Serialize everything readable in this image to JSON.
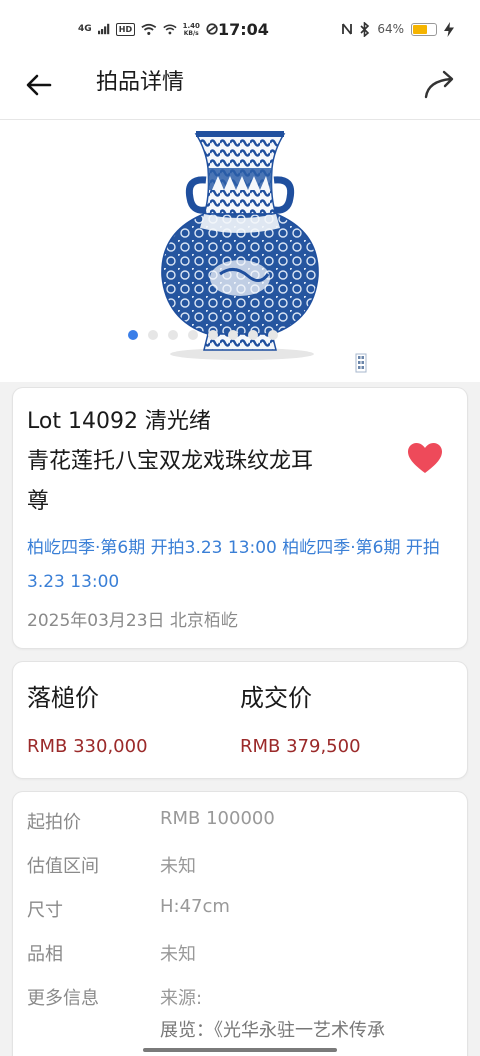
{
  "status_bar": {
    "net_type": "4G",
    "hd": "HD",
    "speed": "1.40",
    "speed_unit": "KB/s",
    "time": "17:04",
    "battery": "64%",
    "battery_level": 0.64,
    "battery_color": "#f5b400"
  },
  "header": {
    "title": "拍品详情",
    "back_icon": "arrow-left-icon",
    "share_icon": "share-icon"
  },
  "gallery": {
    "dot_count": 8,
    "active_index": 0,
    "accent": "#3a7ee8"
  },
  "lot": {
    "title_line1": "Lot 14092 清光绪",
    "title_line2": "青花莲托八宝双龙戏珠纹龙耳",
    "title_line3": "尊",
    "session": "柏屹四季·第6期 开拍3.23 13:00 柏屹四季·第6期 开拍3.23 13:00",
    "date_location": "2025年03月23日 北京栢屹",
    "favorite_color": "#ee4a5a"
  },
  "prices": {
    "hammer_label": "落槌价",
    "hammer_value": "RMB 330,000",
    "deal_label": "成交价",
    "deal_value": "RMB 379,500",
    "value_color": "#9b2a2a"
  },
  "details": [
    {
      "key": "起拍价",
      "value": "RMB 100000"
    },
    {
      "key": "估值区间",
      "value": "未知"
    },
    {
      "key": "尺寸",
      "value": "H:47cm"
    },
    {
      "key": "品相",
      "value": "未知"
    },
    {
      "key": "更多信息",
      "value": "来源:"
    }
  ],
  "details_extra": "展览：《光华永驻一艺术传承"
}
